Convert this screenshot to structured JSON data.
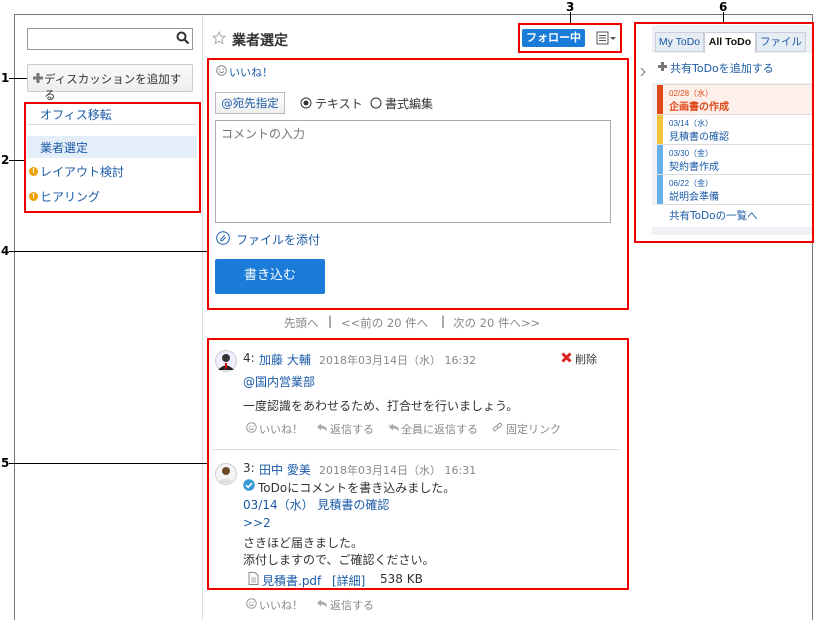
{
  "callouts": [
    "1",
    "2",
    "3",
    "4",
    "5",
    "6"
  ],
  "sidebar": {
    "search_placeholder": "",
    "add_discussion_label": "ディスカッションを追加する",
    "items": [
      {
        "label": "オフィス移転",
        "selected": false,
        "unread": false
      },
      {
        "label": "業者選定",
        "selected": true,
        "unread": false
      },
      {
        "label": "レイアウト検討",
        "selected": false,
        "unread": true
      },
      {
        "label": "ヒアリング",
        "selected": false,
        "unread": true
      }
    ]
  },
  "header": {
    "title": "業者選定",
    "follow_label": "フォロー中"
  },
  "composer": {
    "like_label": "いいね！",
    "address_button_label": "@宛先指定",
    "mode_text_label": "テキスト",
    "mode_rich_label": "書式編集",
    "comment_placeholder": "コメントの入力",
    "attach_label": "ファイルを添付",
    "submit_label": "書き込む"
  },
  "pager": {
    "first": "先頭へ",
    "sep": "|",
    "prev": "<<前の 20 件へ",
    "next": "次の 20 件へ>>"
  },
  "posts": [
    {
      "number": "4:",
      "author": "加藤 大輔",
      "timestamp": "2018年03月14日（水） 16:32",
      "delete_label": "削除",
      "mention": "@国内営業部",
      "body": "一度認識をあわせるため、打合せを行いましょう。",
      "actions": [
        "いいね！",
        "返信する",
        "全員に返信する",
        "固定リンク"
      ]
    },
    {
      "number": "3:",
      "author": "田中 愛美",
      "timestamp": "2018年03月14日（水） 16:31",
      "line1": "ToDoにコメントを書き込みました。",
      "todo_link": "03/14（水）  見積書の確認",
      "reply_ref": ">>2",
      "line2": "さきほど届きました。",
      "line3": "添付しますので、ご確認ください。",
      "attachment_name": "見積書.pdf",
      "attachment_detail": "[詳細]",
      "attachment_size": "538 KB",
      "actions": [
        "いいね！",
        "返信する"
      ]
    }
  ],
  "todo_panel": {
    "tabs": [
      {
        "label": "My ToDo",
        "active": false
      },
      {
        "label": "All ToDo",
        "active": true
      },
      {
        "label": "ファイル",
        "active": false
      }
    ],
    "add_label": "共有ToDoを追加する",
    "items": [
      {
        "date": "02/28（水）",
        "title": "企画書の作成",
        "color": "#e04a1a",
        "overdue": true
      },
      {
        "date": "03/14（水）",
        "title": "見積書の確認",
        "color": "#f5c43c",
        "overdue": false
      },
      {
        "date": "03/30（金）",
        "title": "契約書作成",
        "color": "#6ab0e8",
        "overdue": false
      },
      {
        "date": "06/22（金）",
        "title": "説明会準備",
        "color": "#6ab0e8",
        "overdue": false
      }
    ],
    "list_link": "共有ToDoの一覧へ"
  },
  "colors": {
    "accent": "#1a7bd8",
    "link": "#1a5aa6",
    "annotation": "#e00000",
    "overdue": "#e04a1a"
  }
}
